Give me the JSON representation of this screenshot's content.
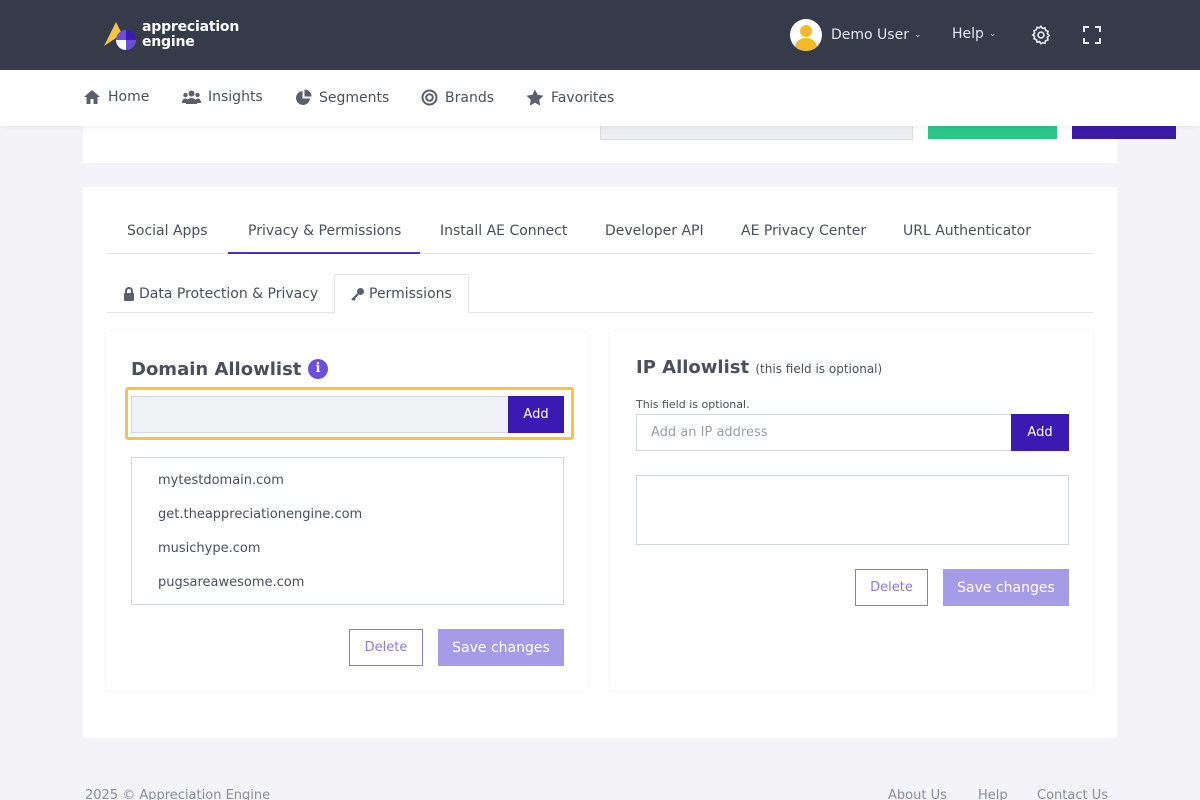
{
  "header": {
    "logo_line1": "appreciation",
    "logo_line2": "engine",
    "user_name": "Demo User",
    "help_label": "Help",
    "icons": [
      "settings-gear-icon",
      "fullscreen-icon"
    ]
  },
  "nav": {
    "items": [
      {
        "label": "Home",
        "icon": "home-icon"
      },
      {
        "label": "Insights",
        "icon": "users-icon"
      },
      {
        "label": "Segments",
        "icon": "pie-chart-icon"
      },
      {
        "label": "Brands",
        "icon": "target-icon"
      },
      {
        "label": "Favorites",
        "icon": "star-icon"
      }
    ]
  },
  "tabs": {
    "items": [
      "Social Apps",
      "Privacy & Permissions",
      "Install AE Connect",
      "Developer API",
      "AE Privacy Center",
      "URL Authenticator"
    ],
    "active": "Privacy & Permissions"
  },
  "subtabs": {
    "items": [
      "Data Protection & Privacy",
      "Permissions"
    ],
    "active": "Permissions"
  },
  "domain_allowlist": {
    "title": "Domain Allowlist",
    "input_value": "",
    "add_label": "Add",
    "domains": [
      "mytestdomain.com",
      "get.theappreciationengine.com",
      "musichype.com",
      "pugsareawesome.com"
    ],
    "delete_label": "Delete",
    "save_label": "Save changes"
  },
  "ip_allowlist": {
    "title": "IP Allowlist",
    "optional_note": "(this field is optional)",
    "hint": "This field is optional.",
    "placeholder": "Add an IP address",
    "add_label": "Add",
    "delete_label": "Delete",
    "save_label": "Save changes"
  },
  "footer": {
    "copyright": "2025 © Appreciation Engine",
    "links": [
      "About Us",
      "Help",
      "Contact Us"
    ]
  },
  "colors": {
    "topbar": "#353b48",
    "accent": "#3a1ab3",
    "highlight": "#f6c343",
    "save_disabled": "#a59be6"
  }
}
